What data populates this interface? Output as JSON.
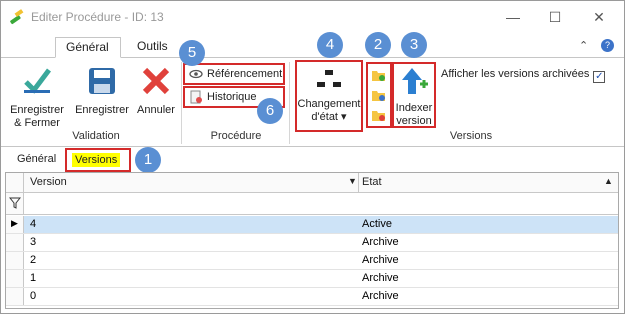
{
  "window": {
    "title": "Editer Procédure - ID: 13"
  },
  "ribbon_tabs": [
    "Général",
    "Outils"
  ],
  "validation": {
    "save_close": "Enregistrer\n& Fermer",
    "save": "Enregistrer",
    "cancel": "Annuler",
    "group": "Validation"
  },
  "procedure": {
    "referencing": "Référencement",
    "history": "Historique",
    "group": "Procédure"
  },
  "versions": {
    "change_state": "Changement\nd'état ▾",
    "index_version": "Indexer\nversion",
    "group": "Versions",
    "show_archived": "Afficher les versions archivées"
  },
  "badges": [
    "5",
    "4",
    "2",
    "3",
    "6",
    "1"
  ],
  "subtabs": [
    "Général",
    "Versions"
  ],
  "grid": {
    "columns": [
      "Version",
      "Etat"
    ],
    "rows": [
      {
        "version": "4",
        "state": "Active"
      },
      {
        "version": "3",
        "state": "Archive"
      },
      {
        "version": "2",
        "state": "Archive"
      },
      {
        "version": "1",
        "state": "Archive"
      },
      {
        "version": "0",
        "state": "Archive"
      }
    ]
  }
}
